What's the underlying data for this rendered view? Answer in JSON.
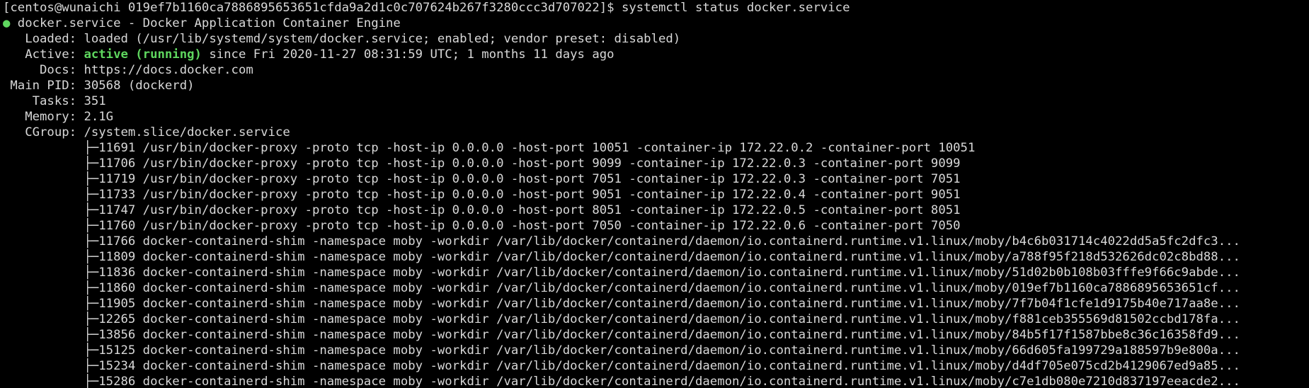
{
  "terminal": {
    "prompt": "[centos@wunaichi 019ef7b1160ca7886895653651cfda9a2d1c0c707624b267f3280ccc3d707022]$ systemctl status docker.service",
    "status_dot": "●",
    "unit_line": " docker.service - Docker Application Container Engine",
    "loaded_label": "   Loaded: ",
    "loaded_value": "loaded (/usr/lib/systemd/system/docker.service; enabled; vendor preset: disabled)",
    "active_label": "   Active: ",
    "active_state": "active (running)",
    "active_since": " since Fri 2020-11-27 08:31:59 UTC; 1 months 11 days ago",
    "docs_label": "     Docs: ",
    "docs_value": "https://docs.docker.com",
    "mainpid_label": " Main PID: ",
    "mainpid_value": "30568 (dockerd)",
    "tasks_label": "    Tasks: ",
    "tasks_value": "351",
    "memory_label": "   Memory: ",
    "memory_value": "2.1G",
    "cgroup_label": "   CGroup: ",
    "cgroup_value": "/system.slice/docker.service",
    "cgroup_processes": [
      "           ├─11691 /usr/bin/docker-proxy -proto tcp -host-ip 0.0.0.0 -host-port 10051 -container-ip 172.22.0.2 -container-port 10051",
      "           ├─11706 /usr/bin/docker-proxy -proto tcp -host-ip 0.0.0.0 -host-port 9099 -container-ip 172.22.0.3 -container-port 9099",
      "           ├─11719 /usr/bin/docker-proxy -proto tcp -host-ip 0.0.0.0 -host-port 7051 -container-ip 172.22.0.3 -container-port 7051",
      "           ├─11733 /usr/bin/docker-proxy -proto tcp -host-ip 0.0.0.0 -host-port 9051 -container-ip 172.22.0.4 -container-port 9051",
      "           ├─11747 /usr/bin/docker-proxy -proto tcp -host-ip 0.0.0.0 -host-port 8051 -container-ip 172.22.0.5 -container-port 8051",
      "           ├─11760 /usr/bin/docker-proxy -proto tcp -host-ip 0.0.0.0 -host-port 7050 -container-ip 172.22.0.6 -container-port 7050",
      "           ├─11766 docker-containerd-shim -namespace moby -workdir /var/lib/docker/containerd/daemon/io.containerd.runtime.v1.linux/moby/b4c6b031714c4022dd5a5fc2dfc3...",
      "           ├─11809 docker-containerd-shim -namespace moby -workdir /var/lib/docker/containerd/daemon/io.containerd.runtime.v1.linux/moby/a788f95f218d532626dc02c8bd88...",
      "           ├─11836 docker-containerd-shim -namespace moby -workdir /var/lib/docker/containerd/daemon/io.containerd.runtime.v1.linux/moby/51d02b0b108b03fffe9f66c9abde...",
      "           ├─11860 docker-containerd-shim -namespace moby -workdir /var/lib/docker/containerd/daemon/io.containerd.runtime.v1.linux/moby/019ef7b1160ca7886895653651cf...",
      "           ├─11905 docker-containerd-shim -namespace moby -workdir /var/lib/docker/containerd/daemon/io.containerd.runtime.v1.linux/moby/7f7b04f1cfe1d9175b40e717aa8e...",
      "           ├─12265 docker-containerd-shim -namespace moby -workdir /var/lib/docker/containerd/daemon/io.containerd.runtime.v1.linux/moby/f881ceb355569d81502ccbd178fa...",
      "           ├─13856 docker-containerd-shim -namespace moby -workdir /var/lib/docker/containerd/daemon/io.containerd.runtime.v1.linux/moby/84b5f17f1587bbe8c36c16358fd9...",
      "           ├─15125 docker-containerd-shim -namespace moby -workdir /var/lib/docker/containerd/daemon/io.containerd.runtime.v1.linux/moby/66d605fa199729a188597b9e800a...",
      "           ├─15234 docker-containerd-shim -namespace moby -workdir /var/lib/docker/containerd/daemon/io.containerd.runtime.v1.linux/moby/d4df705e075cd2b4129067ed9a85...",
      "           ├─15286 docker-containerd-shim -namespace moby -workdir /var/lib/docker/containerd/daemon/io.containerd.runtime.v1.linux/moby/c7e1db080e7210d837197eeacde2..."
    ]
  },
  "colors": {
    "background": "#000000",
    "text": "#d8d8d8",
    "status_green": "#5fd75f"
  }
}
